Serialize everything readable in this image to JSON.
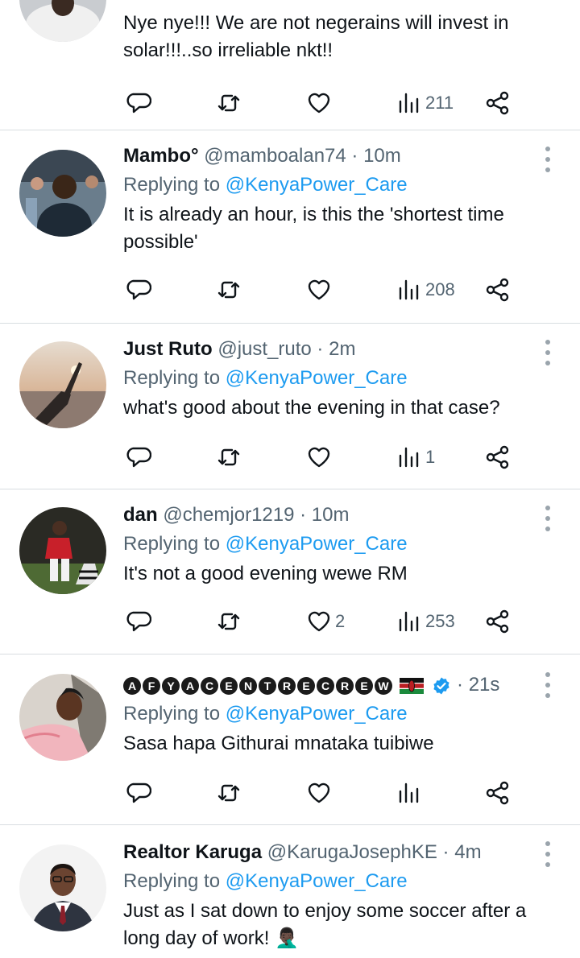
{
  "tweets": [
    {
      "name": "",
      "handle": "",
      "time": "",
      "replying_prefix": "",
      "mention": "",
      "text": "Nye nye!!! We are not negerains will invest in solar!!!..so irreliable nkt!!",
      "likes": "",
      "views": "211"
    },
    {
      "name": "Mambo°",
      "handle": "@mamboalan74",
      "time": "10m",
      "replying_prefix": "Replying to ",
      "mention": "@KenyaPower_Care",
      "text": "It is already an hour, is this the 'shortest time possible'",
      "likes": "",
      "views": "208"
    },
    {
      "name": "Just Ruto",
      "handle": "@just_ruto",
      "time": "2m",
      "replying_prefix": "Replying to ",
      "mention": "@KenyaPower_Care",
      "text": "what's good about the evening in that case?",
      "likes": "",
      "views": "1"
    },
    {
      "name": "dan",
      "handle": "@chemjor1219",
      "time": "10m",
      "replying_prefix": "Replying to ",
      "mention": "@KenyaPower_Care",
      "text": "It's not a good evening wewe RM",
      "likes": "2",
      "views": "253"
    },
    {
      "name": "AFYACENTRECREW",
      "handle": "",
      "time": "21s",
      "replying_prefix": "Replying to ",
      "mention": "@KenyaPower_Care",
      "text": "Sasa hapa Githurai mnataka tuibiwe",
      "likes": "",
      "views": ""
    },
    {
      "name": "Realtor Karuga",
      "handle": "@KarugaJosephKE",
      "time": "4m",
      "replying_prefix": "Replying to ",
      "mention": "@KenyaPower_Care",
      "text": "Just as I sat down to enjoy some soccer after a long day of work! 🤦🏿‍♂️",
      "likes": "",
      "views": ""
    }
  ],
  "separator": " · ",
  "icons": {
    "reply": "speech-bubble-icon",
    "retweet": "retweet-arrows-icon",
    "like": "heart-icon",
    "views": "bar-chart-icon",
    "share": "share-nodes-icon",
    "more": "vertical-ellipsis-icon",
    "verified": "blue-check-icon",
    "flag": "kenya-flag-icon"
  },
  "colors": {
    "text": "#0f1419",
    "muted": "#536471",
    "link": "#1d9bf0",
    "divider": "#d8dde1",
    "verified": "#1d9bf0"
  }
}
